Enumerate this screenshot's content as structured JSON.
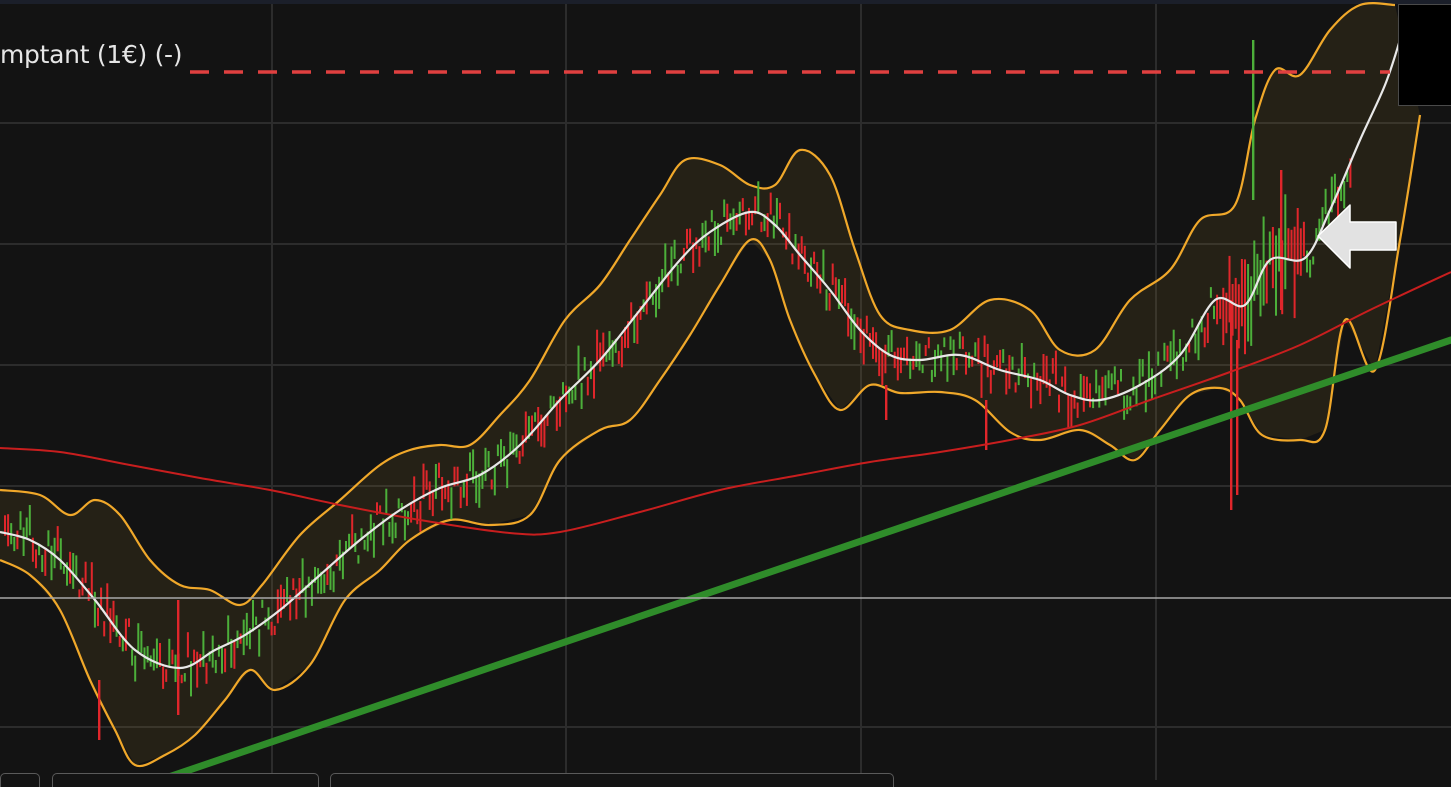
{
  "price_level_label": "mptant (1€) (-)",
  "colors": {
    "background": "#131313",
    "grid": "#2c2c2c",
    "candle_up": "#4caf3a",
    "candle_down": "#e0262b",
    "bollinger_band": "#f0a82a",
    "bollinger_fill": "rgba(150,120,40,0.14)",
    "bollinger_middle": "#e8e8e8",
    "moving_average": "#c81e1e",
    "trend_line": "#2f8c2a",
    "price_level_line": "#e04040",
    "horizontal_line": "#a8a8a8",
    "arrow": "#e2e2e2"
  },
  "icons": [
    "arrow-left-icon"
  ]
}
